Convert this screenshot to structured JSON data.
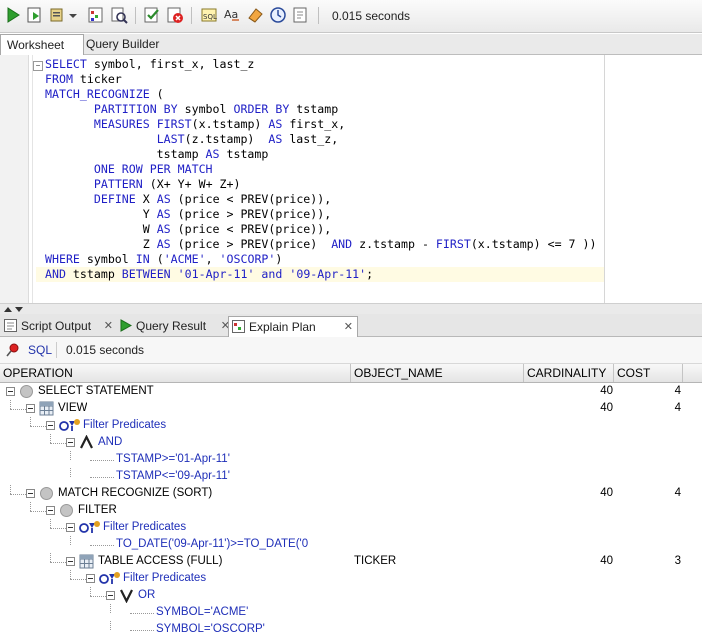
{
  "toolbar": {
    "buttons": [
      "run-statement-icon",
      "run-script-icon",
      "autotrace-icon",
      "explain-plan-icon",
      "sql-tuning-icon",
      "commit-icon",
      "rollback-icon",
      "sql-monitor-icon",
      "format-icon",
      "eraser-icon",
      "history-icon",
      "unshared-worksheet-icon"
    ],
    "elapsed": "0.015 seconds"
  },
  "top_tabs": [
    "Worksheet",
    "Query Builder"
  ],
  "editor": {
    "lines": [
      [
        [
          "kw",
          "SELECT"
        ],
        [
          "t",
          " symbol, first_x, last_z"
        ]
      ],
      [
        [
          "kw",
          "FROM"
        ],
        [
          "t",
          " ticker"
        ]
      ],
      [
        [
          "kw",
          "MATCH_RECOGNIZE"
        ],
        [
          "t",
          " ("
        ]
      ],
      [
        [
          "t",
          "       "
        ],
        [
          "kw",
          "PARTITION BY"
        ],
        [
          "t",
          " symbol "
        ],
        [
          "kw",
          "ORDER BY"
        ],
        [
          "t",
          " tstamp"
        ]
      ],
      [
        [
          "t",
          "       "
        ],
        [
          "kw",
          "MEASURES"
        ],
        [
          "t",
          " "
        ],
        [
          "kw",
          "FIRST"
        ],
        [
          "t",
          "(x.tstamp) "
        ],
        [
          "kw",
          "AS"
        ],
        [
          "t",
          " first_x,"
        ]
      ],
      [
        [
          "t",
          "                "
        ],
        [
          "kw",
          "LAST"
        ],
        [
          "t",
          "(z.tstamp)  "
        ],
        [
          "kw",
          "AS"
        ],
        [
          "t",
          " last_z,"
        ]
      ],
      [
        [
          "t",
          "                tstamp "
        ],
        [
          "kw",
          "AS"
        ],
        [
          "t",
          " tstamp"
        ]
      ],
      [
        [
          "t",
          "       "
        ],
        [
          "kw",
          "ONE ROW PER MATCH"
        ]
      ],
      [
        [
          "t",
          "       "
        ],
        [
          "kw",
          "PATTERN"
        ],
        [
          "t",
          " (X+ Y+ W+ Z+)"
        ]
      ],
      [
        [
          "t",
          "       "
        ],
        [
          "kw",
          "DEFINE"
        ],
        [
          "t",
          " X "
        ],
        [
          "kw",
          "AS"
        ],
        [
          "t",
          " (price < PREV(price)),"
        ]
      ],
      [
        [
          "t",
          "              Y "
        ],
        [
          "kw",
          "AS"
        ],
        [
          "t",
          " (price > PREV(price)),"
        ]
      ],
      [
        [
          "t",
          "              W "
        ],
        [
          "kw",
          "AS"
        ],
        [
          "t",
          " (price < PREV(price)),"
        ]
      ],
      [
        [
          "t",
          "              Z "
        ],
        [
          "kw",
          "AS"
        ],
        [
          "t",
          " (price > PREV(price)  "
        ],
        [
          "kw",
          "AND"
        ],
        [
          "t",
          " z.tstamp - "
        ],
        [
          "kw",
          "FIRST"
        ],
        [
          "t",
          "(x.tstamp) <= 7 ))"
        ]
      ],
      [
        [
          "kw",
          "WHERE"
        ],
        [
          "t",
          " symbol "
        ],
        [
          "kw",
          "IN"
        ],
        [
          "t",
          " ("
        ],
        [
          "str",
          "'ACME'"
        ],
        [
          "t",
          ", "
        ],
        [
          "str",
          "'OSCORP'"
        ],
        [
          "t",
          ")"
        ]
      ],
      [
        [
          "kw",
          "AND"
        ],
        [
          "t",
          " tstamp "
        ],
        [
          "kw",
          "BETWEEN"
        ],
        [
          "t",
          " "
        ],
        [
          "str",
          "'01-Apr-11'"
        ],
        [
          "t",
          " "
        ],
        [
          "kw",
          "and"
        ],
        [
          "t",
          " "
        ],
        [
          "str",
          "'09-Apr-11'"
        ],
        [
          "t",
          ";"
        ]
      ]
    ]
  },
  "bottom_tabs": [
    {
      "label": "Script Output",
      "icon": "script-output-icon"
    },
    {
      "label": "Query Result",
      "icon": "query-result-icon"
    },
    {
      "label": "Explain Plan",
      "icon": "explain-plan-tab-icon"
    }
  ],
  "sqlbar": {
    "sql_label": "SQL",
    "elapsed": "0.015 seconds"
  },
  "grid": {
    "columns": [
      "OPERATION",
      "OBJECT_NAME",
      "CARDINALITY",
      "COST"
    ],
    "rows": [
      {
        "depth": 0,
        "icon": "circle",
        "toggle": true,
        "text": "SELECT STATEMENT",
        "blue": false,
        "object": "",
        "card": "40",
        "cost": "4"
      },
      {
        "depth": 1,
        "icon": "table",
        "toggle": true,
        "text": "VIEW",
        "blue": false,
        "object": "",
        "card": "40",
        "cost": "4"
      },
      {
        "depth": 2,
        "icon": "filter",
        "toggle": true,
        "text": "Filter Predicates",
        "blue": true,
        "object": "",
        "card": "",
        "cost": ""
      },
      {
        "depth": 3,
        "icon": "and",
        "toggle": true,
        "text": "AND",
        "blue": true,
        "object": "",
        "card": "",
        "cost": ""
      },
      {
        "depth": 4,
        "icon": "",
        "toggle": false,
        "text": "TSTAMP>='01-Apr-11'",
        "blue": true,
        "object": "",
        "card": "",
        "cost": ""
      },
      {
        "depth": 4,
        "icon": "",
        "toggle": false,
        "text": "TSTAMP<='09-Apr-11'",
        "blue": true,
        "object": "",
        "card": "",
        "cost": ""
      },
      {
        "depth": 1,
        "icon": "circle",
        "toggle": true,
        "text": "MATCH RECOGNIZE (SORT)",
        "blue": false,
        "object": "",
        "card": "40",
        "cost": "4"
      },
      {
        "depth": 2,
        "icon": "circle",
        "toggle": true,
        "text": "FILTER",
        "blue": false,
        "object": "",
        "card": "",
        "cost": ""
      },
      {
        "depth": 3,
        "icon": "filter",
        "toggle": true,
        "text": "Filter Predicates",
        "blue": true,
        "object": "",
        "card": "",
        "cost": ""
      },
      {
        "depth": 4,
        "icon": "",
        "toggle": false,
        "text": "TO_DATE('09-Apr-11')>=TO_DATE('0",
        "blue": true,
        "object": "",
        "card": "",
        "cost": ""
      },
      {
        "depth": 3,
        "icon": "table",
        "toggle": true,
        "text": "TABLE ACCESS (FULL)",
        "blue": false,
        "object": "TICKER",
        "card": "40",
        "cost": "3"
      },
      {
        "depth": 4,
        "icon": "filter",
        "toggle": true,
        "text": "Filter Predicates",
        "blue": true,
        "object": "",
        "card": "",
        "cost": ""
      },
      {
        "depth": 5,
        "icon": "or",
        "toggle": true,
        "text": "OR",
        "blue": true,
        "object": "",
        "card": "",
        "cost": ""
      },
      {
        "depth": 6,
        "icon": "",
        "toggle": false,
        "text": "SYMBOL='ACME'",
        "blue": true,
        "object": "",
        "card": "",
        "cost": ""
      },
      {
        "depth": 6,
        "icon": "",
        "toggle": false,
        "text": "SYMBOL='OSCORP'",
        "blue": true,
        "object": "",
        "card": "",
        "cost": ""
      }
    ]
  }
}
